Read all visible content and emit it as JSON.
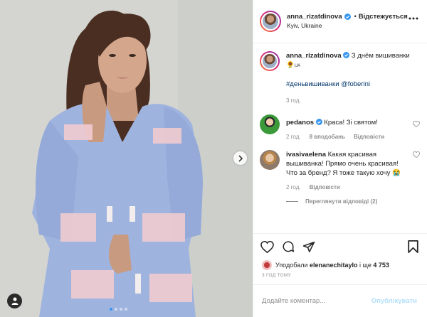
{
  "post": {
    "username": "anna_rizatdinova",
    "separator": "•",
    "follow_state": "Відстежується",
    "location": "Kyiv, Ukraine"
  },
  "caption": {
    "username": "anna_rizatdinova",
    "text": "З днём вишиванки",
    "flag_label": "UA",
    "tags": "#деньвишиванки @foberini",
    "time": "3 год."
  },
  "comments": [
    {
      "username": "pedanos",
      "text": "Краса! Зі святом!",
      "time": "2 год.",
      "likes": "8 вподобань",
      "reply": "Відповісти"
    },
    {
      "username": "ivasivaelena",
      "text": "Какая красивая вышиванка! Прямо очень красивая! Что за бренд? Я тоже такую хочу",
      "emoji": "😭",
      "time": "2 год.",
      "reply": "Відповісти",
      "view_replies": "Переглянути відповіді (2)"
    }
  ],
  "likes_line": {
    "prefix": "Уподобали",
    "user": "elenanechitaylo",
    "suffix": "і ще",
    "count": "4 753"
  },
  "timestamp": "3 ГОД ТОМУ",
  "add_comment": {
    "placeholder": "Додайте коментар...",
    "publish": "Опублікувати"
  },
  "carousel": {
    "slides": 4,
    "active_index": 0
  },
  "colors": {
    "accent": "#3897f0",
    "publish_disabled": "#b2dffc",
    "meta": "#8e8e8e",
    "dress": "#9fb3df"
  },
  "icons": [
    "chevron-right-icon",
    "user-tag-icon",
    "verified-icon",
    "more-icon",
    "heart-icon",
    "comment-icon",
    "share-icon",
    "bookmark-icon"
  ]
}
